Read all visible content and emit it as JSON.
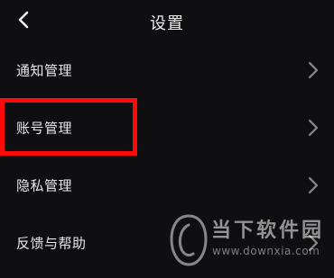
{
  "header": {
    "title": "设置",
    "back_icon": "chevron-left-icon"
  },
  "menu": {
    "items": [
      {
        "label": "通知管理",
        "icon": "chevron-right-icon"
      },
      {
        "label": "账号管理",
        "icon": "chevron-right-icon",
        "highlighted": true
      },
      {
        "label": "隐私管理",
        "icon": "chevron-right-icon"
      },
      {
        "label": "反馈与帮助",
        "icon": "chevron-right-icon"
      }
    ]
  },
  "annotation": {
    "highlight_color": "#ff0a0a"
  },
  "watermark": {
    "name": "当下软件园",
    "url": "www.downxia.com"
  },
  "colors": {
    "background": "#0f0f11",
    "text": "#e8e8e8",
    "chevron": "#8a8a8a"
  }
}
